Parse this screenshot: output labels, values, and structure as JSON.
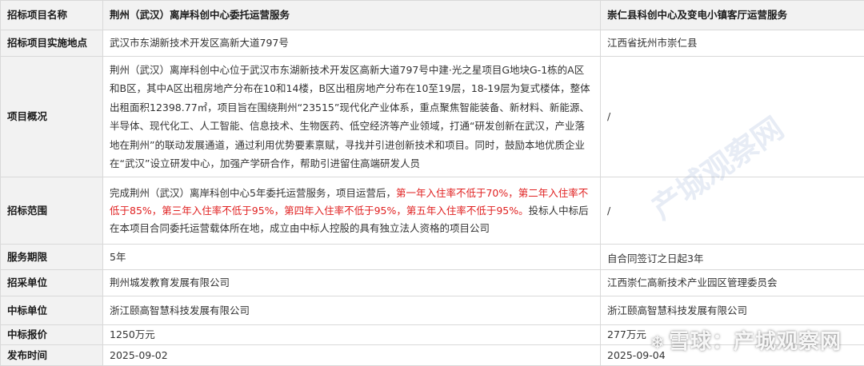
{
  "header": {
    "label": "招标项目名称",
    "project1": "荆州（武汉）离岸科创中心委托运营服务",
    "project2": "崇仁县科创中心及变电小镇客厅运营服务"
  },
  "rows": {
    "location": {
      "label": "招标项目实施地点",
      "v1": "武汉市东湖新技术开发区高新大道797号",
      "v2": "江西省抚州市崇仁县"
    },
    "overview": {
      "label": "项目概况",
      "v1": "荆州（武汉）离岸科创中心位于武汉市东湖新技术开发区高新大道797号中建·光之星项目G地块G-1栋的A区和B区，其中A区出租房地产分布在10和14楼，B区出租房地产分布在10至19层，18-19层为复式楼体，整体出租面积12398.77㎡，项目旨在围绕荆州“23515”现代化产业体系，重点聚焦智能装备、新材料、新能源、半导体、现代化工、人工智能、信息技术、生物医药、低空经济等产业领域，打通“研发创新在武汉，产业落地在荆州”的联动发展通道，通过利用优势要素禀赋，寻找并引进创新技术和项目。同时，鼓励本地优质企业在“武汉”设立研发中心，加强产学研合作，帮助引进留住高端研发人员",
      "v2": "/"
    },
    "scope": {
      "label": "招标范围",
      "v1_pre": "完成荆州（武汉）离岸科创中心5年委托运营服务，项目运营后，",
      "v1_hl": "第一年入住率不低于70%，第二年入住率不低于85%，第三年入住率不低于95%，第四年入住率不低于95%，第五年入住率不低于95%。",
      "v1_post": "投标人中标后在本项目合同委托运营载体所在地，成立由中标人控股的具有独立法人资格的项目公司",
      "v2": "/"
    },
    "period": {
      "label": "服务期限",
      "v1": "5年",
      "v2": "自合同签订之日起3年"
    },
    "buyer": {
      "label": "招采单位",
      "v1": "荆州城发教育发展有限公司",
      "v2": "江西崇仁高新技术产业园区管理委员会"
    },
    "winner": {
      "label": "中标单位",
      "v1": "浙江颐高智慧科技发展有限公司",
      "v2": "浙江颐高智慧科技发展有限公司"
    },
    "price": {
      "label": "中标报价",
      "v1": "1250万元",
      "v2": "277万元"
    },
    "date": {
      "label": "发布时间",
      "v1": "2025-09-02",
      "v2": "2025-09-04"
    }
  },
  "watermark": {
    "text": "雪球：产城观察网",
    "diag": "产城观察网"
  },
  "colors": {
    "highlight": "#e02020",
    "label_bg": "#f2f2f2",
    "border": "#d9d9d9"
  }
}
